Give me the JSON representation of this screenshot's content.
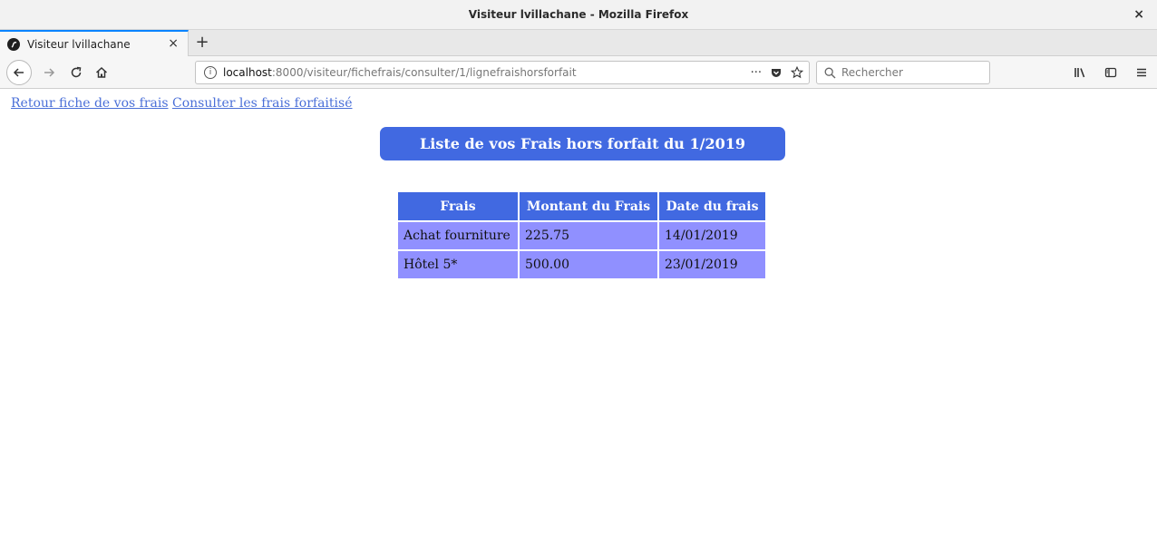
{
  "window": {
    "title": "Visiteur lvillachane - Mozilla Firefox",
    "close_glyph": "×"
  },
  "tab": {
    "label": "Visiteur lvillachane",
    "close_glyph": "×",
    "new_tab_glyph": "+"
  },
  "navbar": {
    "url_host": "localhost",
    "url_path": ":8000/visiteur/fichefrais/consulter/1/lignefraishorsforfait",
    "search_placeholder": "Rechercher",
    "more_glyph": "···"
  },
  "page": {
    "links": {
      "back": "Retour fiche de vos frais",
      "forfait": "Consulter les frais forfaitisé"
    },
    "heading": "Liste de vos Frais hors forfait du 1/2019",
    "table": {
      "headers": [
        "Frais",
        "Montant du Frais",
        "Date du frais"
      ],
      "rows": [
        [
          "Achat fourniture",
          "225.75",
          "14/01/2019"
        ],
        [
          "Hôtel 5*",
          "500.00",
          "23/01/2019"
        ]
      ]
    }
  },
  "colors": {
    "heading_bg": "#4169e1",
    "cell_bg": "#9090ff",
    "link": "#4a6fd8",
    "tab_accent": "#0a84ff"
  }
}
